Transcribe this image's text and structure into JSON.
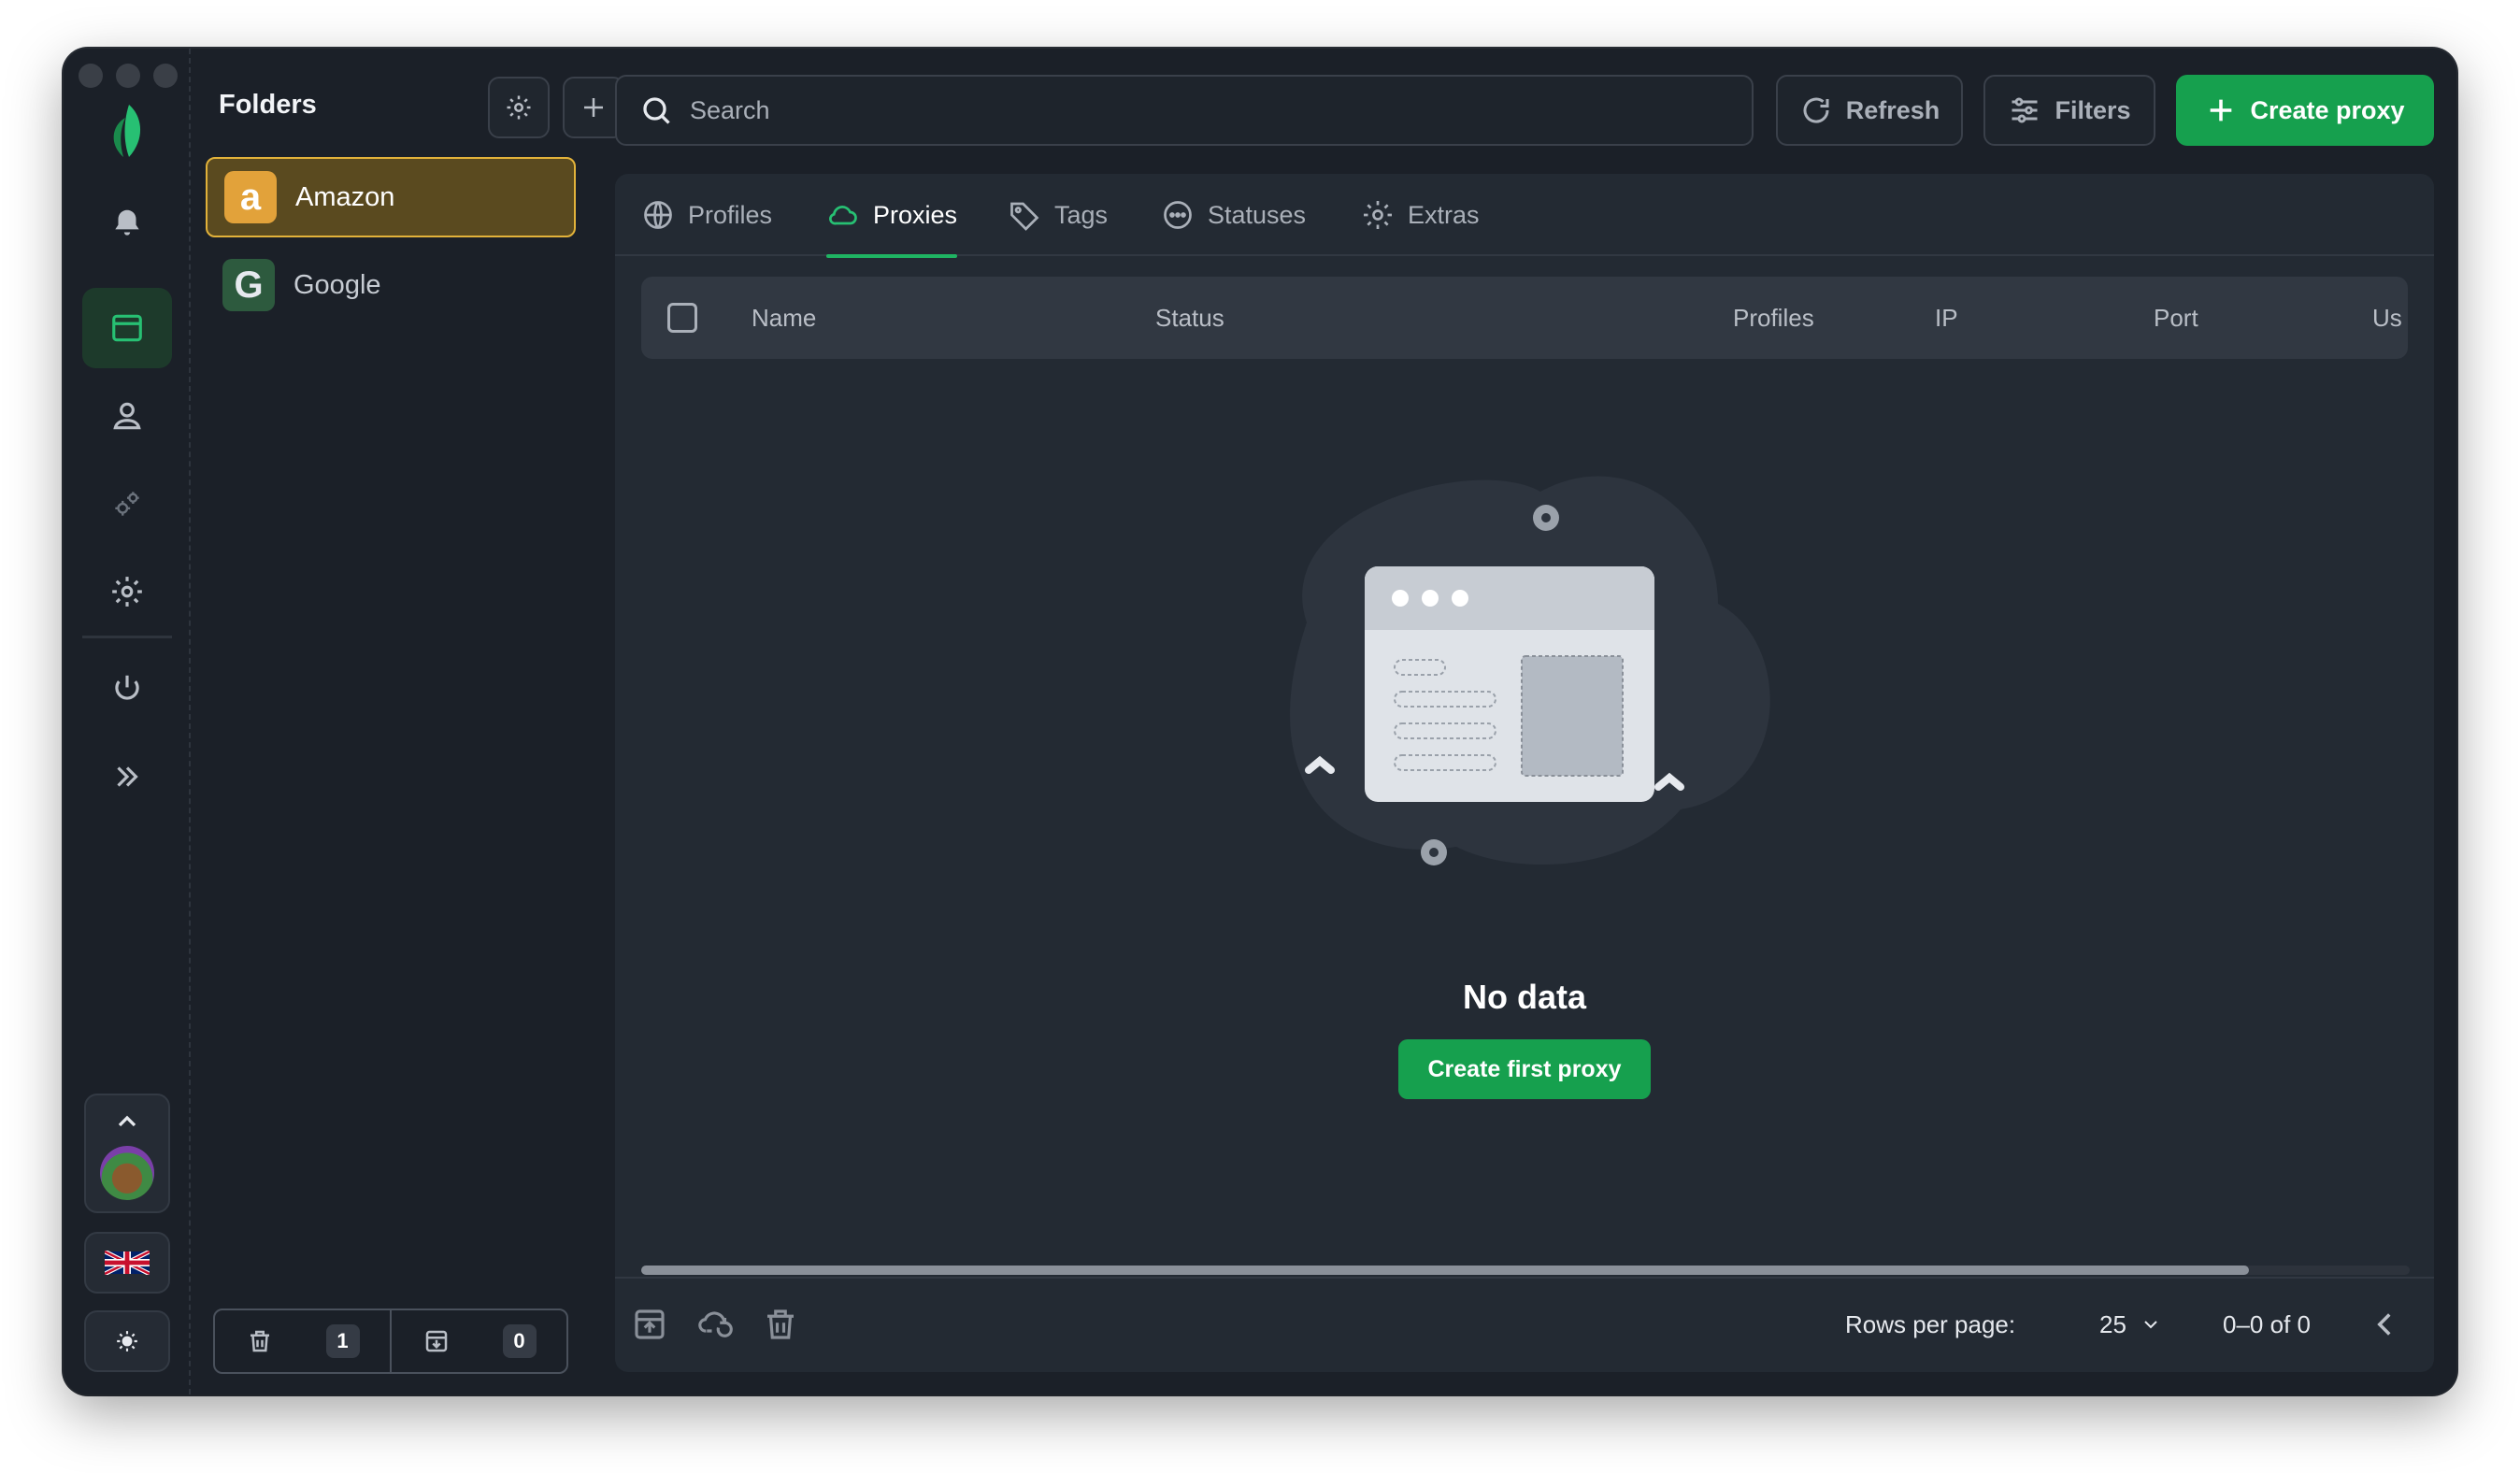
{
  "sidebar": {
    "folders_title": "Folders",
    "folders": [
      {
        "label": "Amazon",
        "icon_letter": "a",
        "active": true
      },
      {
        "label": "Google",
        "icon_letter": "G",
        "active": false
      }
    ],
    "trash_count": "1",
    "archive_count": "0"
  },
  "toolbar": {
    "search_placeholder": "Search",
    "refresh_label": "Refresh",
    "filters_label": "Filters",
    "create_label": "Create proxy"
  },
  "tabs": [
    {
      "label": "Profiles",
      "icon": "globe-icon"
    },
    {
      "label": "Proxies",
      "icon": "cloud-icon",
      "active": true
    },
    {
      "label": "Tags",
      "icon": "tag-icon"
    },
    {
      "label": "Statuses",
      "icon": "dots-circle-icon"
    },
    {
      "label": "Extras",
      "icon": "gear-icon"
    }
  ],
  "table": {
    "columns": [
      "Name",
      "Status",
      "Profiles",
      "IP",
      "Port",
      "Us"
    ]
  },
  "empty_state": {
    "title": "No data",
    "button_label": "Create first proxy"
  },
  "pagination": {
    "rows_per_page_label": "Rows per page:",
    "rows_per_page_value": "25",
    "range_text": "0–0 of 0"
  },
  "colors": {
    "accent": "#16a04e",
    "folder_highlight": "#e2b23a",
    "background": "#1b2028"
  }
}
